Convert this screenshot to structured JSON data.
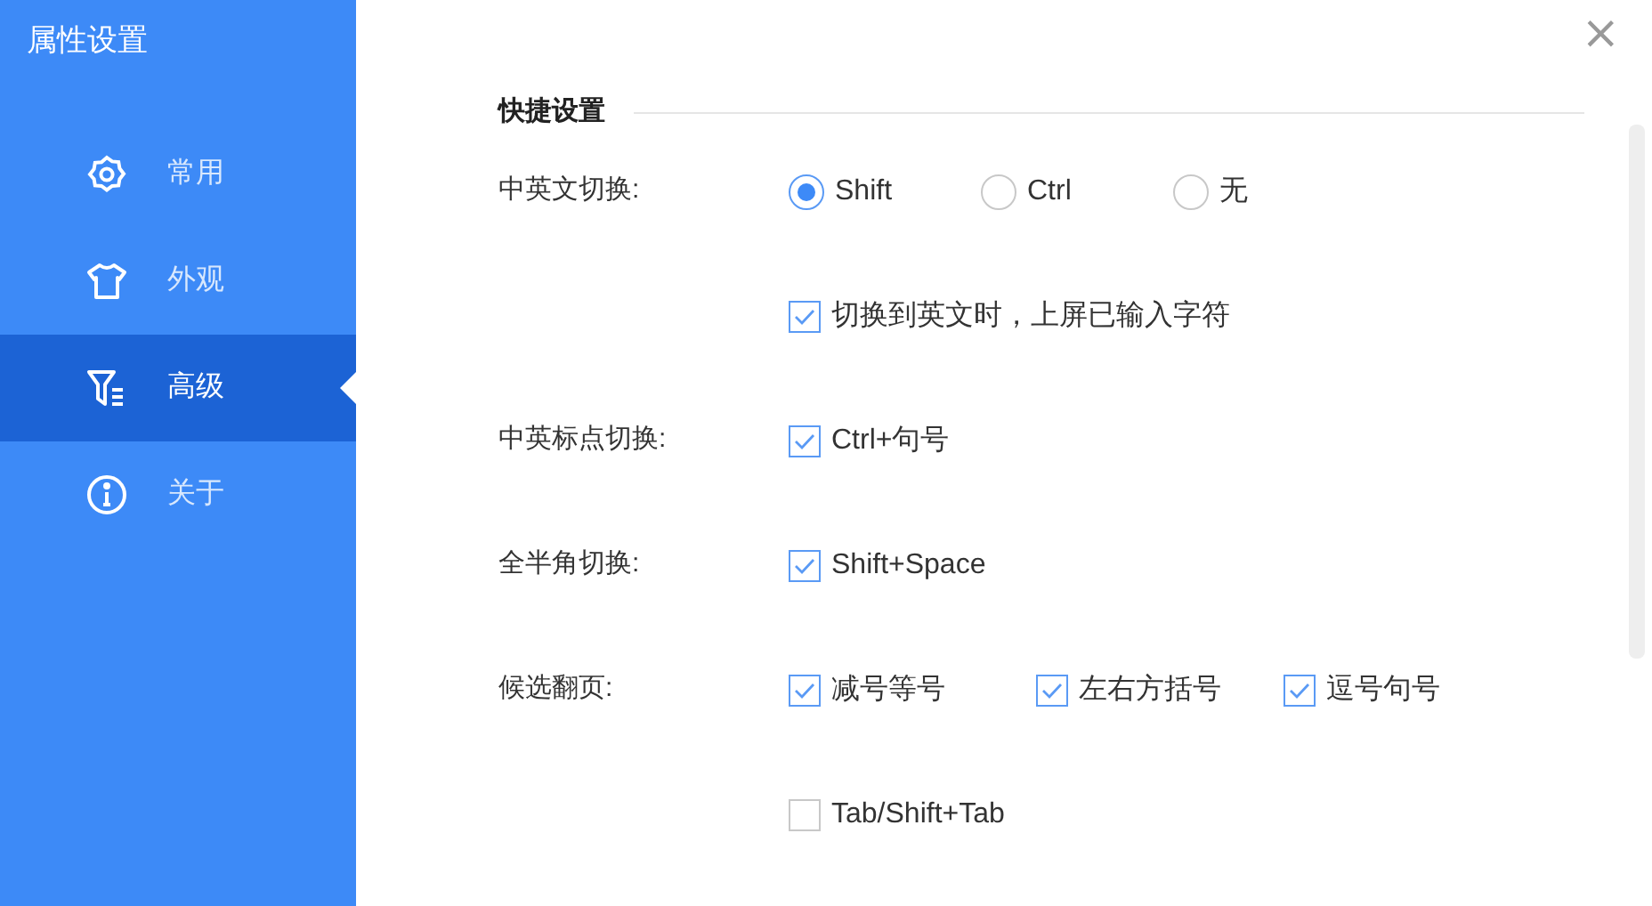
{
  "sidebar": {
    "title": "属性设置",
    "items": [
      {
        "label": "常用",
        "selected": false
      },
      {
        "label": "外观",
        "selected": false
      },
      {
        "label": "高级",
        "selected": true
      },
      {
        "label": "关于",
        "selected": false
      }
    ]
  },
  "close": "×",
  "section": {
    "title": "快捷设置",
    "rows": [
      {
        "label": "中英文切换:",
        "options": [
          {
            "kind": "radio",
            "label": "Shift",
            "selected": true
          },
          {
            "kind": "radio",
            "label": "Ctrl",
            "selected": false
          },
          {
            "kind": "radio",
            "label": "无",
            "selected": false
          }
        ]
      },
      {
        "options": [
          {
            "kind": "checkbox",
            "label": "切换到英文时，上屏已输入字符",
            "checked": true
          }
        ]
      },
      {
        "label": "中英标点切换:",
        "options": [
          {
            "kind": "checkbox",
            "label": "Ctrl+句号",
            "checked": true
          }
        ]
      },
      {
        "label": "全半角切换:",
        "options": [
          {
            "kind": "checkbox",
            "label": "Shift+Space",
            "checked": true
          }
        ]
      },
      {
        "label": "候选翻页:",
        "options": [
          {
            "kind": "checkbox",
            "label": "减号等号",
            "checked": true
          },
          {
            "kind": "checkbox",
            "label": "左右方括号",
            "checked": true
          },
          {
            "kind": "checkbox",
            "label": "逗号句号",
            "checked": true
          }
        ]
      },
      {
        "options": [
          {
            "kind": "checkbox",
            "label": "Tab/Shift+Tab",
            "checked": false
          }
        ]
      }
    ]
  }
}
